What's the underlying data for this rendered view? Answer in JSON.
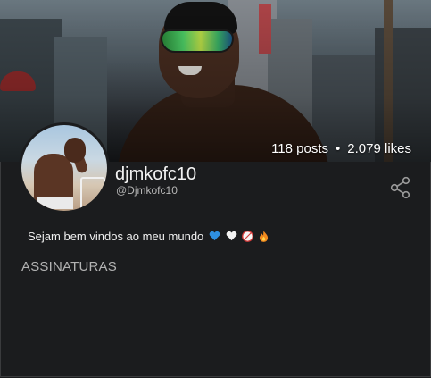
{
  "profile": {
    "display_name": "djmkofc10",
    "handle": "@Djmkofc10",
    "bio": "Sejam bem vindos ao meu mundo",
    "bio_emojis": [
      "blue-heart",
      "white-heart",
      "18-plus",
      "fire"
    ]
  },
  "stats": {
    "posts": "118 posts",
    "separator": "•",
    "likes": "2.079 likes"
  },
  "sections": {
    "subscriptions_title": "ASSINATURAS"
  },
  "icons": {
    "share": "share-icon"
  },
  "colors": {
    "background": "#1b1c1e",
    "text_primary": "#f2f2f2",
    "text_secondary": "#b7b7b7"
  }
}
